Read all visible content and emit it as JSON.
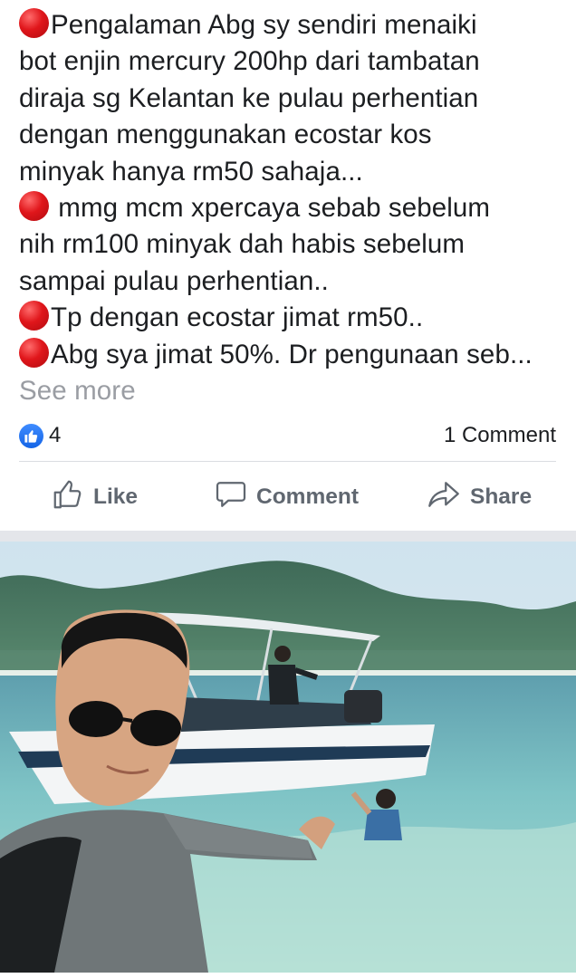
{
  "post": {
    "lines": [
      "Pengalaman Abg sy sendiri menaiki",
      "bot enjin mercury 200hp dari tambatan",
      "diraja sg Kelantan ke pulau perhentian",
      "dengan menggunakan ecostar kos",
      "minyak hanya rm50 sahaja...",
      " mmg mcm xpercaya sebab sebelum",
      "nih rm100 minyak dah habis sebelum",
      "sampai pulau perhentian..",
      "Tp dengan ecostar jimat rm50..",
      "Abg sya jimat 50%. Dr pengunaan seb..."
    ],
    "see_more": "See more"
  },
  "stats": {
    "like_count": "4",
    "comments": "1 Comment"
  },
  "actions": {
    "like": "Like",
    "comment": "Comment",
    "share": "Share"
  },
  "colors": {
    "accent_blue": "#1464e6",
    "bullet_red": "#e0161b",
    "action_gray": "#606770"
  },
  "icons": {
    "bullet": "red-circle-emoji",
    "like_badge": "thumbs-up-icon",
    "like": "thumbs-up-outline-icon",
    "comment": "speech-bubble-icon",
    "share": "share-arrow-icon"
  }
}
